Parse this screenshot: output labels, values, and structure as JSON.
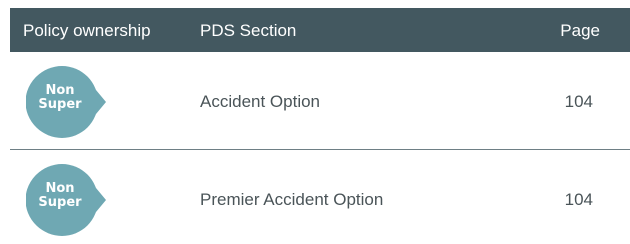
{
  "table": {
    "headers": {
      "ownership": "Policy ownership",
      "section": "PDS Section",
      "page": "Page"
    },
    "rows": [
      {
        "badge": {
          "line1": "Non",
          "line2": "Super",
          "icon": "non-super-badge-icon",
          "color": "#6fa8b3"
        },
        "section": "Accident Option",
        "page": "104"
      },
      {
        "badge": {
          "line1": "Non",
          "line2": "Super",
          "icon": "non-super-badge-icon",
          "color": "#6fa8b3"
        },
        "section": "Premier Accident Option",
        "page": "104"
      }
    ]
  },
  "colors": {
    "header_bg": "#435860",
    "header_text": "#ffffff",
    "body_text": "#4a5458",
    "divider": "#6e7f85"
  }
}
